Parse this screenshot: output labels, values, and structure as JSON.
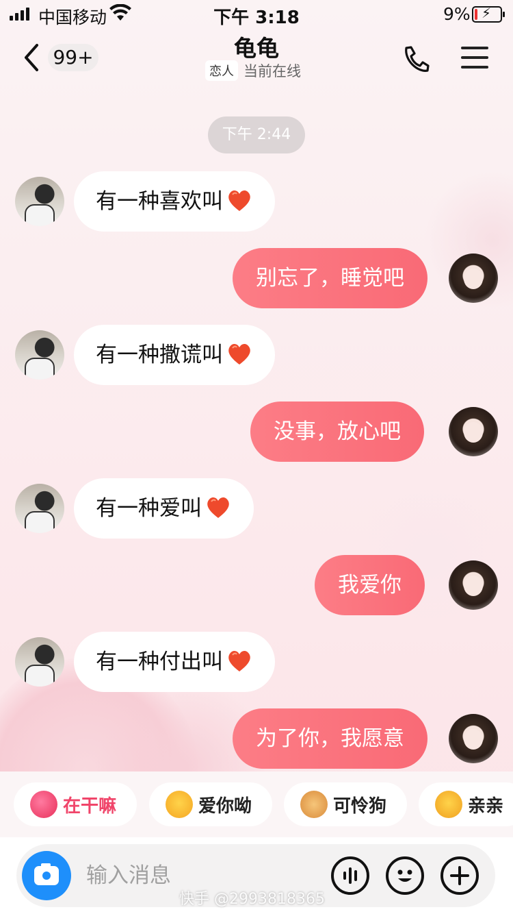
{
  "status_bar": {
    "carrier": "中国移动",
    "time": "下午 3:18",
    "battery_percent": "9%",
    "battery_level": 0.09
  },
  "nav": {
    "unread_count": "99+",
    "contact_name": "龟龟",
    "relation_tag": "恋人",
    "online_status": "当前在线"
  },
  "timestamp": "下午 2:44",
  "messages": [
    {
      "side": "in",
      "text": "有一种喜欢叫"
    },
    {
      "side": "out",
      "text": "别忘了，睡觉吧"
    },
    {
      "side": "in",
      "text": "有一种撒谎叫"
    },
    {
      "side": "out",
      "text": "没事，放心吧"
    },
    {
      "side": "in",
      "text": "有一种爱叫"
    },
    {
      "side": "out",
      "text": "我爱你"
    },
    {
      "side": "in",
      "text": "有一种付出叫"
    },
    {
      "side": "out",
      "text": "为了你，我愿意"
    }
  ],
  "quick_replies": [
    {
      "label": "在干嘛",
      "icon": "gift-emoji-icon"
    },
    {
      "label": "爱你呦",
      "icon": "heart-eyes-emoji-icon"
    },
    {
      "label": "可怜狗",
      "icon": "dog-emoji-icon"
    },
    {
      "label": "亲亲",
      "icon": "hug-emoji-icon"
    }
  ],
  "input": {
    "placeholder": "输入消息"
  },
  "watermark": "快手 @2993818365",
  "colors": {
    "outgoing_bubble": "#fa737e",
    "camera_button": "#1e8ffb",
    "quick_reply_accent": "#f0456a"
  }
}
